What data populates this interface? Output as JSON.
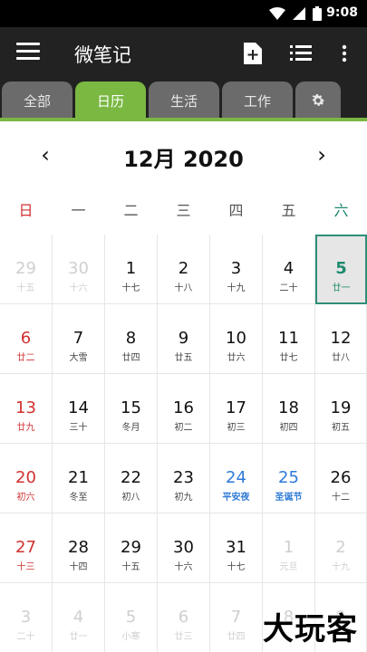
{
  "status_bar": {
    "time": "9:08",
    "icons": [
      "wifi-icon",
      "signal-icon",
      "battery-icon"
    ]
  },
  "app_bar": {
    "title": "微笔记",
    "actions": [
      "add-note-icon",
      "list-icon",
      "more-vert-icon"
    ]
  },
  "tabs": [
    {
      "label": "全部"
    },
    {
      "label": "日历",
      "active": true
    },
    {
      "label": "生活"
    },
    {
      "label": "工作"
    },
    {
      "label": "",
      "icon": "gear-icon"
    }
  ],
  "calendar": {
    "month_label": "12月 2020",
    "prev": "‹",
    "next": "›",
    "weekdays": [
      "日",
      "一",
      "二",
      "三",
      "四",
      "五",
      "六"
    ],
    "weeks": [
      [
        {
          "d": "29",
          "l": "十五",
          "s": "dim"
        },
        {
          "d": "30",
          "l": "十六",
          "s": "dim"
        },
        {
          "d": "1",
          "l": "十七"
        },
        {
          "d": "2",
          "l": "十八"
        },
        {
          "d": "3",
          "l": "十九"
        },
        {
          "d": "4",
          "l": "二十"
        },
        {
          "d": "5",
          "l": "廿一",
          "s": "today"
        }
      ],
      [
        {
          "d": "6",
          "l": "廿二",
          "s": "red"
        },
        {
          "d": "7",
          "l": "大雪"
        },
        {
          "d": "8",
          "l": "廿四"
        },
        {
          "d": "9",
          "l": "廿五"
        },
        {
          "d": "10",
          "l": "廿六"
        },
        {
          "d": "11",
          "l": "廿七"
        },
        {
          "d": "12",
          "l": "廿八"
        }
      ],
      [
        {
          "d": "13",
          "l": "廿九",
          "s": "red"
        },
        {
          "d": "14",
          "l": "三十"
        },
        {
          "d": "15",
          "l": "冬月"
        },
        {
          "d": "16",
          "l": "初二"
        },
        {
          "d": "17",
          "l": "初三"
        },
        {
          "d": "18",
          "l": "初四"
        },
        {
          "d": "19",
          "l": "初五"
        }
      ],
      [
        {
          "d": "20",
          "l": "初六",
          "s": "red"
        },
        {
          "d": "21",
          "l": "冬至"
        },
        {
          "d": "22",
          "l": "初八"
        },
        {
          "d": "23",
          "l": "初九"
        },
        {
          "d": "24",
          "l": "平安夜",
          "s": "blue"
        },
        {
          "d": "25",
          "l": "圣诞节",
          "s": "blue"
        },
        {
          "d": "26",
          "l": "十二"
        }
      ],
      [
        {
          "d": "27",
          "l": "十三",
          "s": "red"
        },
        {
          "d": "28",
          "l": "十四"
        },
        {
          "d": "29",
          "l": "十五"
        },
        {
          "d": "30",
          "l": "十六"
        },
        {
          "d": "31",
          "l": "十七"
        },
        {
          "d": "1",
          "l": "元旦",
          "s": "dim"
        },
        {
          "d": "2",
          "l": "十九",
          "s": "dim"
        }
      ],
      [
        {
          "d": "3",
          "l": "二十",
          "s": "dim"
        },
        {
          "d": "4",
          "l": "廿一",
          "s": "dim"
        },
        {
          "d": "5",
          "l": "小寒",
          "s": "dim"
        },
        {
          "d": "6",
          "l": "廿三",
          "s": "dim"
        },
        {
          "d": "7",
          "l": "廿四",
          "s": "dim"
        },
        {
          "d": "8",
          "l": "",
          "s": "dim"
        },
        {
          "d": "9",
          "l": "",
          "s": "dim"
        }
      ]
    ]
  },
  "colors": {
    "accent": "#7ab842",
    "appbar": "#222222",
    "today_border": "#2f8f78",
    "holiday_blue": "#2e7ad6",
    "sunday_red": "#d23030"
  },
  "watermark": {
    "text": "大玩客"
  }
}
